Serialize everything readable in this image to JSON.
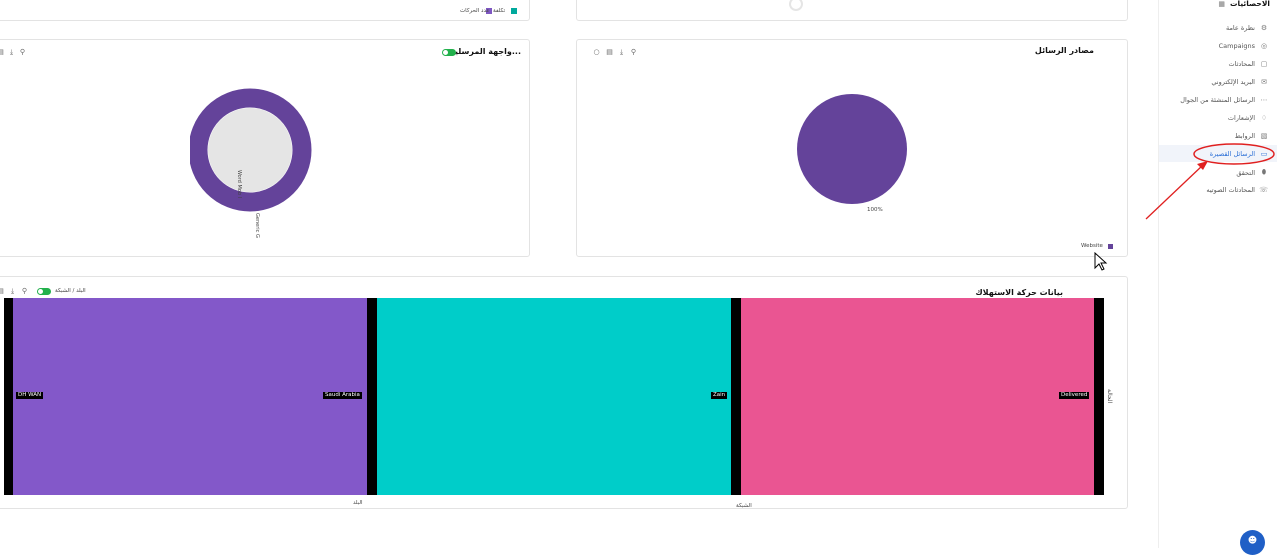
{
  "top_left_card": {
    "legend": [
      {
        "label": "تكلفة",
        "color": "#00a99d"
      },
      {
        "label": "عدد الحركات",
        "color": "#7e57c2"
      }
    ]
  },
  "senders_card": {
    "title": "...واجهة المرسلين",
    "donut_labels": [
      "Word Mob I",
      "Generic G"
    ]
  },
  "sources_card": {
    "title": "مصادر الرسائل",
    "pie_percent": "100%",
    "legend_label": "Website",
    "legend_color": "#64439a"
  },
  "traffic_card": {
    "title": "بيانات حركة الاستهلاك",
    "toggle_label": "البلد / الشبكة",
    "side_label": "الحالة",
    "axis_label_country": "البلد",
    "axis_label_network": "الشبكة",
    "bands": [
      {
        "label": "Delivered",
        "color": "#ea5592"
      },
      {
        "label": "Zain",
        "color": "#00cdc9"
      },
      {
        "label": "Saudi Arabia",
        "color": "#8358c9"
      },
      {
        "label": "DH WAN",
        "color": "#8358c9"
      }
    ]
  },
  "sidebar": {
    "title": "الاحصائيات",
    "items": [
      {
        "label": "نظرة عامة",
        "icon": "gear-icon",
        "active": false
      },
      {
        "label": "Campaigns",
        "icon": "target-icon",
        "active": false
      },
      {
        "label": "المحادثات",
        "icon": "chat-icon",
        "active": false
      },
      {
        "label": "البريد الإلكتروني",
        "icon": "mail-icon",
        "active": false
      },
      {
        "label": "الرسائل المنشئة من الجوال",
        "icon": "dots-icon",
        "active": false
      },
      {
        "label": "الإشعارات",
        "icon": "bell-icon",
        "active": false
      },
      {
        "label": "الروابط",
        "icon": "link-icon",
        "active": false
      },
      {
        "label": "الرسائل القصيرة",
        "icon": "message-icon",
        "active": true
      },
      {
        "label": "التحقق",
        "icon": "shield-icon",
        "active": false
      },
      {
        "label": "المحادثات الصوتيه",
        "icon": "voice-icon",
        "active": false
      }
    ]
  }
}
